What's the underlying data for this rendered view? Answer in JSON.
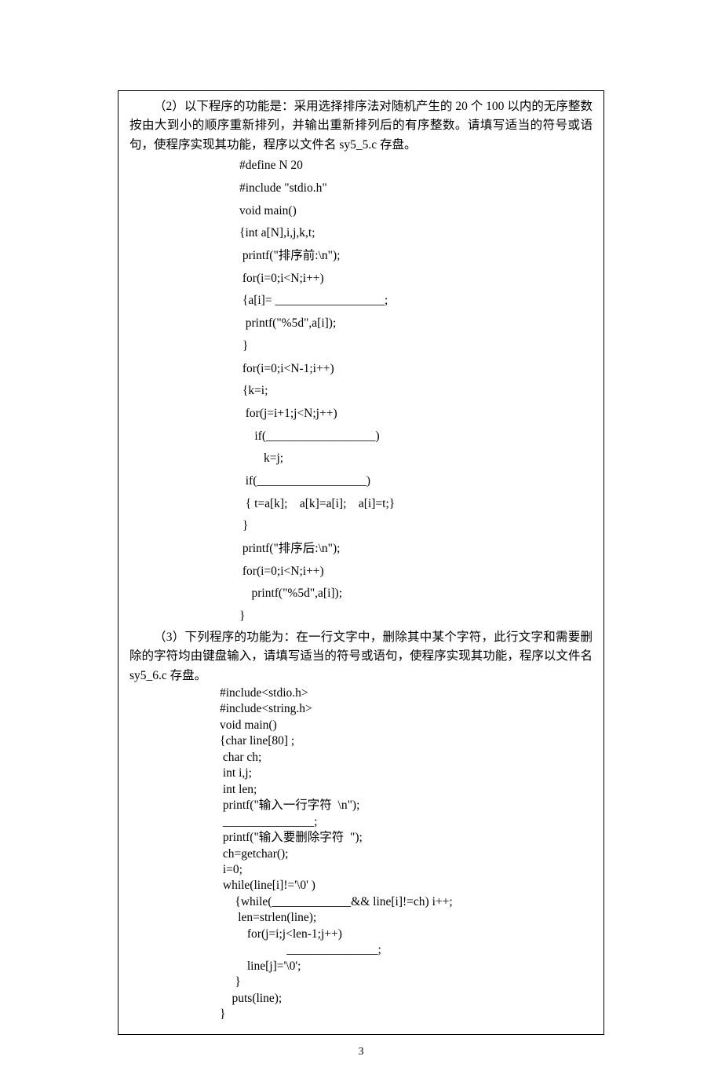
{
  "q2": {
    "intro": "（2）以下程序的功能是：采用选择排序法对随机产生的 20 个 100 以内的无序整数按由大到小的顺序重新排列，并输出重新排列后的有序整数。请填写适当的符号或语句，使程序实现其功能，程序以文件名 sy5_5.c 存盘。",
    "code": "#define N 20\n#include \"stdio.h\"\nvoid main()\n{int a[N],i,j,k,t;\n printf(\"排序前:\\n\");\n for(i=0;i<N;i++)\n {a[i]= __________________;\n  printf(\"%5d\",a[i]);\n }\n for(i=0;i<N-1;i++)\n {k=i;\n  for(j=i+1;j<N;j++)\n     if(__________________)\n        k=j;\n  if(__________________)\n  { t=a[k];    a[k]=a[i];    a[i]=t;}\n }\n printf(\"排序后:\\n\");\n for(i=0;i<N;i++)\n    printf(\"%5d\",a[i]);\n}"
  },
  "q3": {
    "intro": "（3）下列程序的功能为：在一行文字中，删除其中某个字符，此行文字和需要删除的字符均由键盘输入，请填写适当的符号或语句，使程序实现其功能，程序以文件名 sy5_6.c 存盘。",
    "code": "#include<stdio.h>\n#include<string.h>\nvoid main()\n{char line[80] ;\n char ch;\n int i,j;\n int len;\n printf(\"输入一行字符  \\n\");\n _______________;\n printf(\"输入要删除字符  \");\n ch=getchar();\n i=0;\n while(line[i]!='\\0' )\n     {while(_____________&& line[i]!=ch) i++;\n      len=strlen(line);\n         for(j=i;j<len-1;j++)\n                      _______________;\n         line[j]='\\0';\n     }\n    puts(line);\n}"
  },
  "pageNumber": "3"
}
